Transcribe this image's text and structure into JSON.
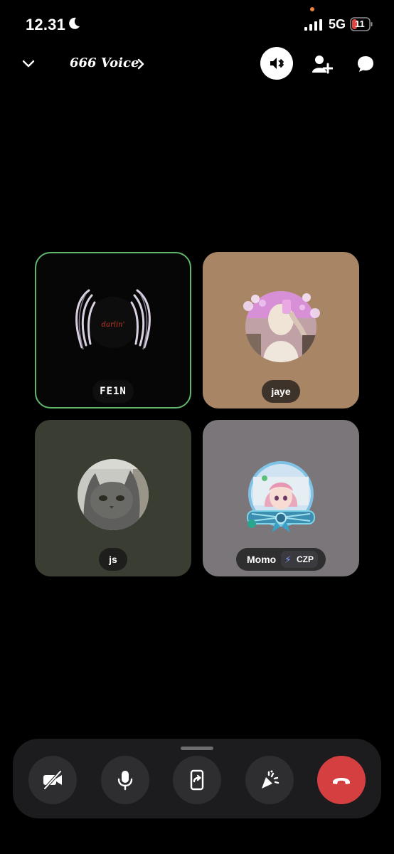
{
  "status_bar": {
    "time": "12.31",
    "network": "5G",
    "battery": "11"
  },
  "header": {
    "channel_name": "666 Voice"
  },
  "participants": [
    {
      "name": "FE1N",
      "speaking": true,
      "tile_color": "#060606",
      "avatar_text": "darlin'"
    },
    {
      "name": "jaye",
      "speaking": false,
      "tile_color": "#a88565"
    },
    {
      "name": "js",
      "speaking": false,
      "tile_color": "#3a3d32"
    },
    {
      "name": "Momo",
      "speaking": false,
      "tile_color": "#7a7679",
      "tag": "CZP"
    }
  ],
  "controls": [
    "camera-off-icon",
    "microphone-icon",
    "screen-share-icon",
    "activity-icon",
    "end-call-icon"
  ],
  "colors": {
    "speaking_ring": "#5fb86a",
    "end_call": "#d63f3f",
    "dock": "#1c1c1e"
  }
}
